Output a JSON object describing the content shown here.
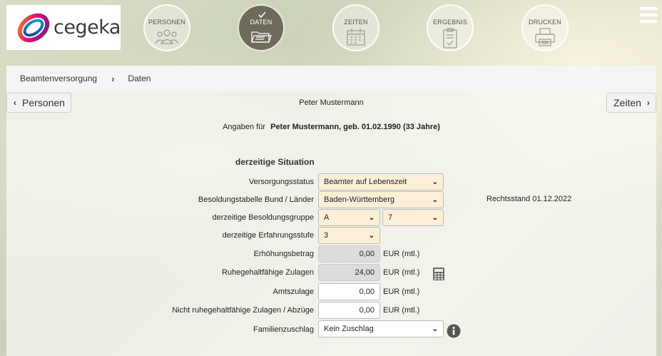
{
  "header": {
    "logo_text": "cegeka",
    "steps": [
      {
        "label": "PERSONEN",
        "icon": "people-icon"
      },
      {
        "label": "DATEN",
        "icon": "folder-open-icon",
        "active": true
      },
      {
        "label": "ZEITEN",
        "icon": "calendar-icon"
      },
      {
        "label": "ERGEBNIS",
        "icon": "clipboard-check-icon"
      },
      {
        "label": "DRUCKEN",
        "icon": "printer-icon"
      }
    ]
  },
  "breadcrumb": [
    "Beamtenversorgung",
    "Daten"
  ],
  "nav": {
    "prev": "Personen",
    "next": "Zeiten"
  },
  "person": {
    "name": "Peter Mustermann",
    "intro_label": "Angaben für",
    "intro_detail": "Peter Mustermann, geb. 01.02.1990 (33 Jahre)"
  },
  "section": {
    "title": "derzeitige Situation"
  },
  "form": {
    "versorgungsstatus": {
      "label": "Versorgungsstatus",
      "value": "Beamter auf Lebenszeit"
    },
    "besoldungstabelle": {
      "label": "Besoldungstabelle Bund / Länder",
      "value": "Baden-Württemberg"
    },
    "rechtsstand": "Rechtsstand 01.12.2022",
    "besoldungsgruppe": {
      "label": "derzeitige Besoldungsgruppe",
      "value": "A",
      "value2": "7"
    },
    "erfahrungsstufe": {
      "label": "derzeitige Erfahrungsstufe",
      "value": "3"
    },
    "erhoehungsbetrag": {
      "label": "Erhöhungsbetrag",
      "value": "0,00",
      "unit": "EUR (mtl.)"
    },
    "ruhegehaltfaehige_zulagen": {
      "label": "Ruhegehaltfähige Zulagen",
      "value": "24,00",
      "unit": "EUR (mtl.)"
    },
    "amtszulage": {
      "label": "Amtszulage",
      "value": "0,00",
      "unit": "EUR (mtl.)"
    },
    "nicht_ruhegehaltfaehige": {
      "label": "Nicht ruhegehaltfähige Zulagen / Abzüge",
      "value": "0,00",
      "unit": "EUR (mtl.)"
    },
    "familienzuschlag": {
      "label": "Familienzuschlag",
      "value": "Kein Zuschlag"
    }
  },
  "colors": {
    "select_bg": "#fcefd8",
    "active_step": "#6e6b5c",
    "readonly_bg": "#dcdcdc"
  }
}
